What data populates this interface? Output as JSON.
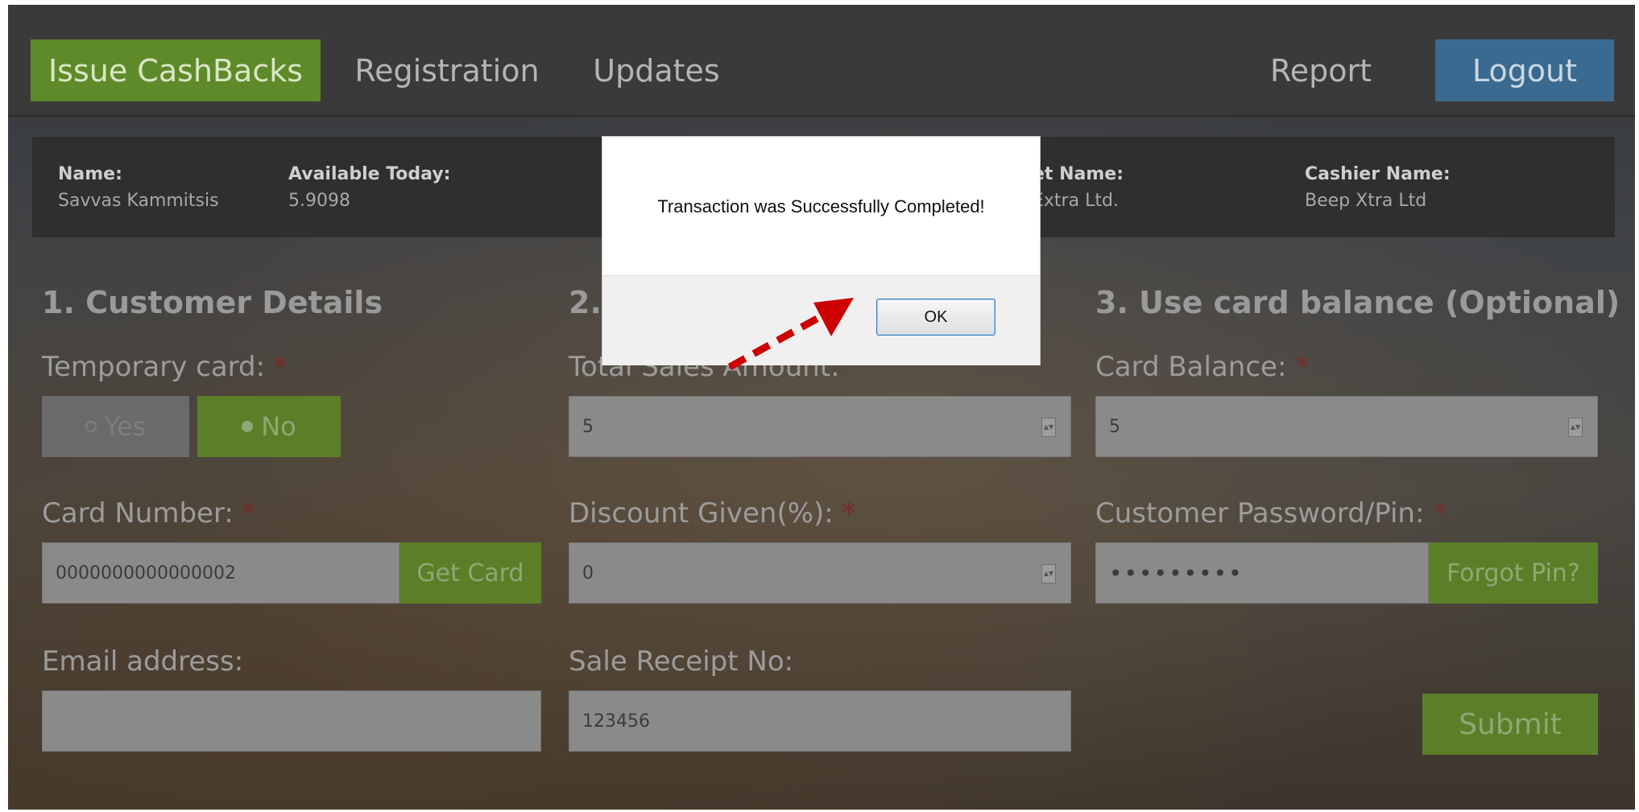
{
  "navbar": {
    "issue_cashbacks": "Issue CashBacks",
    "registration": "Registration",
    "updates": "Updates",
    "report": "Report",
    "logout": "Logout"
  },
  "info": {
    "name_label": "Name:",
    "name_value": "Savvas Kammitsis",
    "available_label": "Available Today:",
    "available_value": "5.9098",
    "outlet_label": "et Name:",
    "outlet_value": "Extra Ltd.",
    "cashier_label": "Cashier Name:",
    "cashier_value": "Beep Xtra Ltd"
  },
  "sections": {
    "customer_details": "1. Customer Details",
    "sale_details_partial": "2.",
    "card_balance": "3. Use card balance (Optional)"
  },
  "form": {
    "temporary_card_label": "Temporary card:",
    "required_mark": "*",
    "radio_yes": "Yes",
    "radio_no": "No",
    "card_number_label": "Card Number:",
    "card_number_value": "0000000000000002",
    "get_card_button": "Get Card",
    "email_label": "Email address:",
    "email_value": "",
    "total_sales_label_partial": "Total Sales Amount:",
    "total_sales_value": "5",
    "discount_label": "Discount Given(%):",
    "discount_value": "0",
    "receipt_label": "Sale Receipt No:",
    "receipt_value": "123456",
    "card_balance_label": "Card Balance:",
    "card_balance_value": "5",
    "password_label": "Customer Password/Pin:",
    "password_value": "•••••••••",
    "forgot_pin_button": "Forgot Pin?",
    "submit_button": "Submit"
  },
  "dialog": {
    "message": "Transaction was Successfully Completed!",
    "ok_button": "OK"
  },
  "colors": {
    "primary_green": "#5f8a2a",
    "logout_blue": "#3a6a8f",
    "annotation_red": "#cc0000"
  }
}
